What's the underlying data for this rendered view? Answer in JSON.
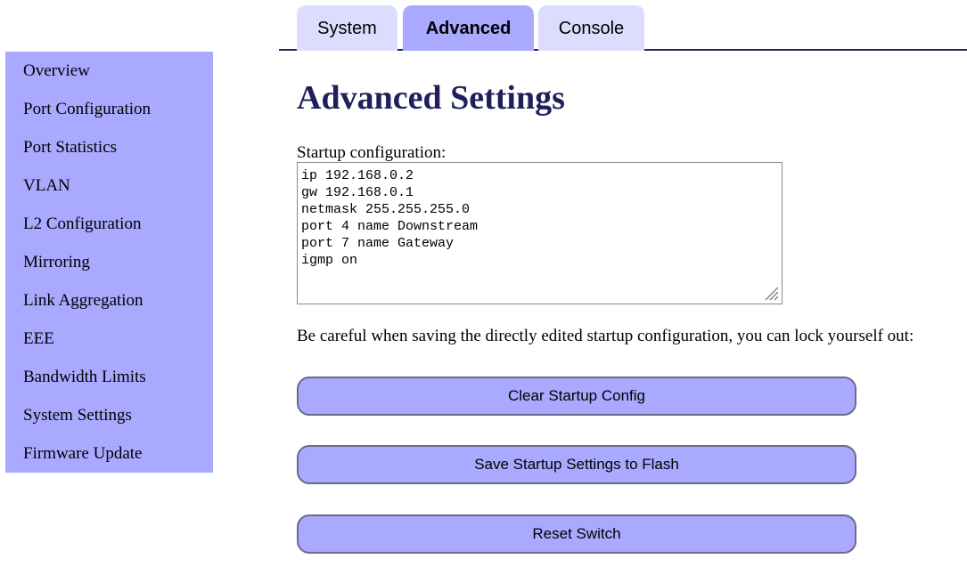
{
  "sidebar": {
    "items": [
      {
        "label": "Overview"
      },
      {
        "label": "Port Configuration"
      },
      {
        "label": "Port Statistics"
      },
      {
        "label": "VLAN"
      },
      {
        "label": "L2 Configuration"
      },
      {
        "label": "Mirroring"
      },
      {
        "label": "Link Aggregation"
      },
      {
        "label": "EEE"
      },
      {
        "label": "Bandwidth Limits"
      },
      {
        "label": "System Settings"
      },
      {
        "label": "Firmware Update"
      }
    ]
  },
  "tabs": [
    {
      "label": "System",
      "active": false
    },
    {
      "label": "Advanced",
      "active": true
    },
    {
      "label": "Console",
      "active": false
    }
  ],
  "main": {
    "title": "Advanced Settings",
    "config_label": "Startup configuration:",
    "config_text": "ip 192.168.0.2\ngw 192.168.0.1\nnetmask 255.255.255.0\nport 4 name Downstream\nport 7 name Gateway\nigmp on",
    "warning": "Be careful when saving the directly edited startup configuration, you can lock yourself out:",
    "buttons": {
      "clear": "Clear Startup Config",
      "save": "Save Startup Settings to Flash",
      "reset": "Reset Switch"
    }
  },
  "colors": {
    "accent": "#a9a9ff",
    "tab_inactive": "#dcdcff",
    "title": "#1f1f5c"
  }
}
